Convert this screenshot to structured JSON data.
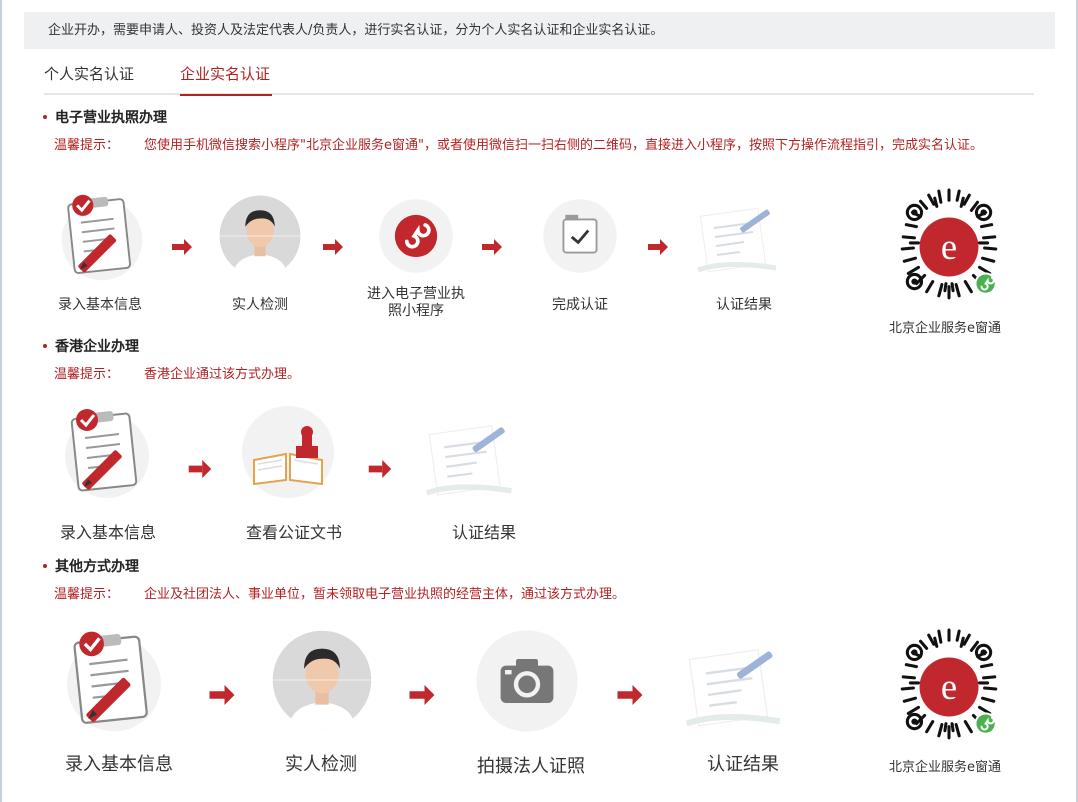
{
  "notice": "企业开办，需要申请人、投资人及法定代表人/负责人，进行实名认证，分为个人实名认证和企业实名认证。",
  "tabs": [
    {
      "label": "个人实名认证",
      "active": false
    },
    {
      "label": "企业实名认证",
      "active": true
    }
  ],
  "tip_label": "温馨提示：",
  "qr_caption": "北京企业服务e窗通",
  "sections": [
    {
      "title": "电子营业执照办理",
      "tip": "您使用手机微信搜索小程序\"北京企业服务e窗通\"，或者使用微信扫一扫右侧的二维码，直接进入小程序，按照下方操作流程指引，完成实名认证。",
      "steps": [
        {
          "label": "录入基本信息",
          "icon": "clipboard-icon"
        },
        {
          "label": "实人检测",
          "icon": "person-face-icon"
        },
        {
          "label": "进入电子营业执照小程序",
          "icon": "mini-program-icon"
        },
        {
          "label": "完成认证",
          "icon": "checkbox-icon"
        },
        {
          "label": "认证结果",
          "icon": "document-pen-icon"
        }
      ]
    },
    {
      "title": "香港企业办理",
      "tip": "香港企业通过该方式办理。",
      "steps": [
        {
          "label": "录入基本信息",
          "icon": "clipboard-icon"
        },
        {
          "label": "查看公证文书",
          "icon": "stamp-book-icon"
        },
        {
          "label": "认证结果",
          "icon": "document-pen-icon"
        }
      ]
    },
    {
      "title": "其他方式办理",
      "tip": "企业及社团法人、事业单位，暂未领取电子营业执照的经营主体，通过该方式办理。",
      "steps": [
        {
          "label": "录入基本信息",
          "icon": "clipboard-icon"
        },
        {
          "label": "实人检测",
          "icon": "person-face-icon"
        },
        {
          "label": "拍摄法人证照",
          "icon": "camera-icon"
        },
        {
          "label": "认证结果",
          "icon": "document-pen-icon"
        }
      ]
    }
  ],
  "colors": {
    "accent": "#b22222",
    "tip": "#b22222",
    "notice_bg": "#eff0f2",
    "circle_bg": "#f2f2f2"
  }
}
